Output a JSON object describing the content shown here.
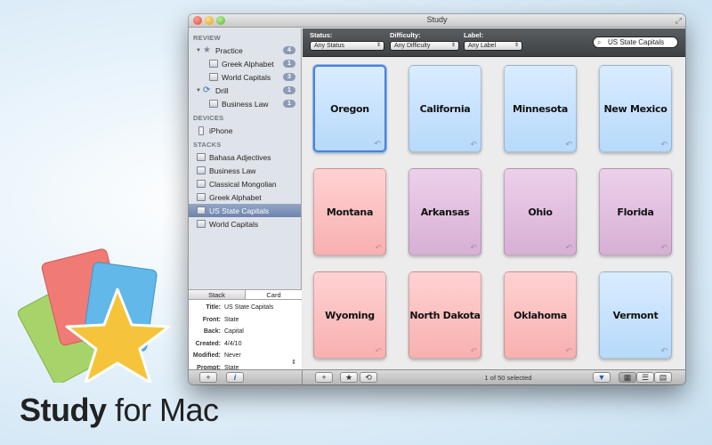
{
  "promo": {
    "title_bold": "Study",
    "title_rest": " for Mac",
    "logo_icon": "star-cards-logo-icon"
  },
  "window": {
    "title": "Study"
  },
  "sidebar": {
    "sections": {
      "review": "REVIEW",
      "devices": "DEVICES",
      "stacks": "STACKS"
    },
    "review_items": [
      {
        "label": "Practice",
        "badge": "4",
        "icon": "star-icon"
      },
      {
        "label": "Greek Alphabet",
        "badge": "1",
        "icon": "stack-icon"
      },
      {
        "label": "World Capitals",
        "badge": "3",
        "icon": "stack-icon"
      },
      {
        "label": "Drill",
        "badge": "1",
        "icon": "drill-icon"
      },
      {
        "label": "Business Law",
        "badge": "1",
        "icon": "stack-icon"
      }
    ],
    "devices": [
      {
        "label": "iPhone",
        "icon": "iphone-icon"
      }
    ],
    "stacks": [
      {
        "label": "Bahasa Adjectives"
      },
      {
        "label": "Business Law"
      },
      {
        "label": "Classical Mongolian"
      },
      {
        "label": "Greek Alphabet"
      },
      {
        "label": "US State Capitals",
        "selected": true
      },
      {
        "label": "World Capitals"
      }
    ]
  },
  "info": {
    "tabs": [
      "Stack",
      "Card"
    ],
    "active_tab": "Card",
    "rows": [
      {
        "key": "Title:",
        "value": "US State Capitals"
      },
      {
        "key": "Front:",
        "value": "State"
      },
      {
        "key": "Back:",
        "value": "Capital"
      },
      {
        "key": "Created:",
        "value": "4/4/10"
      },
      {
        "key": "Modified:",
        "value": "Never"
      },
      {
        "key": "Prompt:",
        "value": "State"
      }
    ]
  },
  "filters": {
    "status_label": "Status:",
    "status_value": "Any Status",
    "difficulty_label": "Difficulty:",
    "difficulty_value": "Any Difficulty",
    "label_label": "Label:",
    "label_value": "Any Label",
    "search_value": "US State Capitals"
  },
  "cards": [
    {
      "text": "Oregon",
      "color": "blue",
      "selected": true
    },
    {
      "text": "California",
      "color": "blue"
    },
    {
      "text": "Minnesota",
      "color": "blue"
    },
    {
      "text": "New Mexico",
      "color": "blue"
    },
    {
      "text": "Montana",
      "color": "red"
    },
    {
      "text": "Arkansas",
      "color": "purple"
    },
    {
      "text": "Ohio",
      "color": "purple"
    },
    {
      "text": "Florida",
      "color": "purple"
    },
    {
      "text": "Wyoming",
      "color": "red"
    },
    {
      "text": "North Dakota",
      "color": "red"
    },
    {
      "text": "Oklahoma",
      "color": "red"
    },
    {
      "text": "Vermont",
      "color": "blue"
    }
  ],
  "bottombar": {
    "status": "1 of 50 selected",
    "add_symbol": "+",
    "info_symbol": "i",
    "star_symbol": "★",
    "flip_symbol": "⟲",
    "filter_symbol": "▼",
    "grid_symbol": "▦",
    "list_symbol": "☰",
    "detail_symbol": "▤"
  },
  "colors": {
    "card_blue": "#c6e1fd",
    "card_red": "#fbc0c0",
    "card_purple": "#e0bfdf",
    "selection": "#4a83d6"
  }
}
